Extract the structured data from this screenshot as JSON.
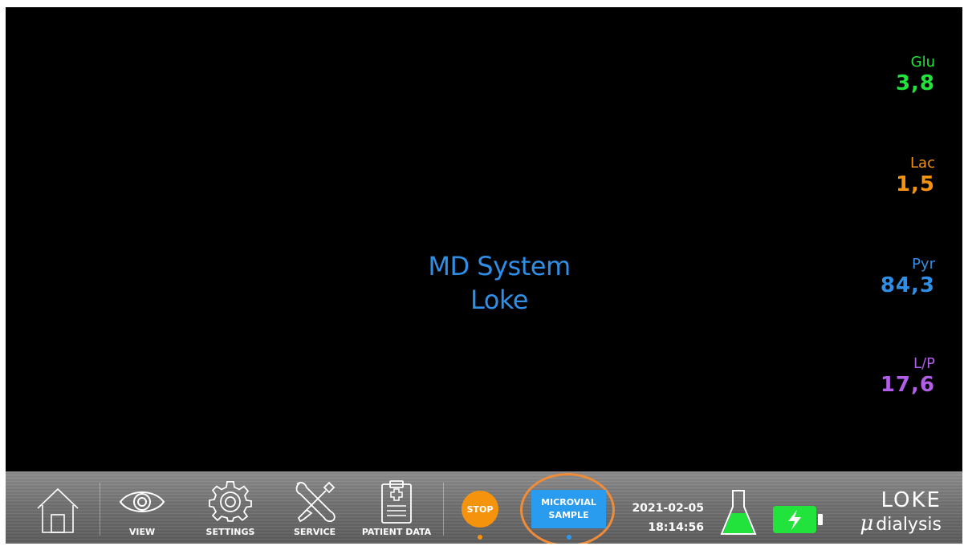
{
  "center": {
    "line1": "MD System",
    "line2": "Loke"
  },
  "readouts": [
    {
      "label": "Glu",
      "value": "3,8",
      "color": "#22e33c"
    },
    {
      "label": "Lac",
      "value": "1,5",
      "color": "#f5930d"
    },
    {
      "label": "Pyr",
      "value": "84,3",
      "color": "#2f8fe6"
    },
    {
      "label": "L/P",
      "value": "17,6",
      "color": "#b25ee8"
    }
  ],
  "toolbar": {
    "home_icon": "home-icon",
    "view_label": "VIEW",
    "settings_label": "SETTINGS",
    "service_label": "SERVICE",
    "patient_data_label": "PATIENT DATA",
    "stop_label": "STOP",
    "microvial_line1": "MICROVIAL",
    "microvial_line2": "SAMPLE",
    "date": "2021-02-05",
    "time": "18:14:56",
    "flask_icon": "flask-icon",
    "battery_icon": "battery-charging-icon",
    "logo_line1": "LOKE",
    "logo_mu": "μ",
    "logo_line2": "dialysis"
  },
  "colors": {
    "title_blue": "#2f8fe6",
    "stop_orange": "#f5930d",
    "microvial_blue": "#2a9cf0",
    "highlight_ring": "#ee8c3a",
    "flask_green": "#22e33c",
    "battery_green": "#22e33c"
  }
}
